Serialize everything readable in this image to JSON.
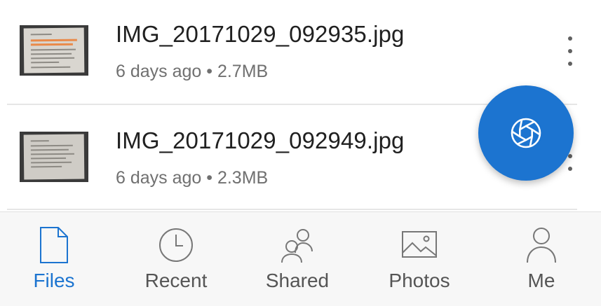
{
  "files": [
    {
      "name": "IMG_20171029_092935.jpg",
      "meta": "6 days ago • 2.7MB"
    },
    {
      "name": "IMG_20171029_092949.jpg",
      "meta": "6 days ago • 2.3MB"
    }
  ],
  "fab": {
    "icon": "camera-shutter-icon"
  },
  "bottom_nav": {
    "items": [
      {
        "label": "Files",
        "icon": "file-icon",
        "active": true
      },
      {
        "label": "Recent",
        "icon": "clock-icon",
        "active": false
      },
      {
        "label": "Shared",
        "icon": "people-icon",
        "active": false
      },
      {
        "label": "Photos",
        "icon": "image-icon",
        "active": false
      },
      {
        "label": "Me",
        "icon": "person-icon",
        "active": false
      }
    ]
  },
  "colors": {
    "accent": "#1c74d0",
    "text_primary": "#202020",
    "text_secondary": "#707070",
    "nav_inactive": "#555555",
    "nav_background": "#f7f7f7"
  }
}
